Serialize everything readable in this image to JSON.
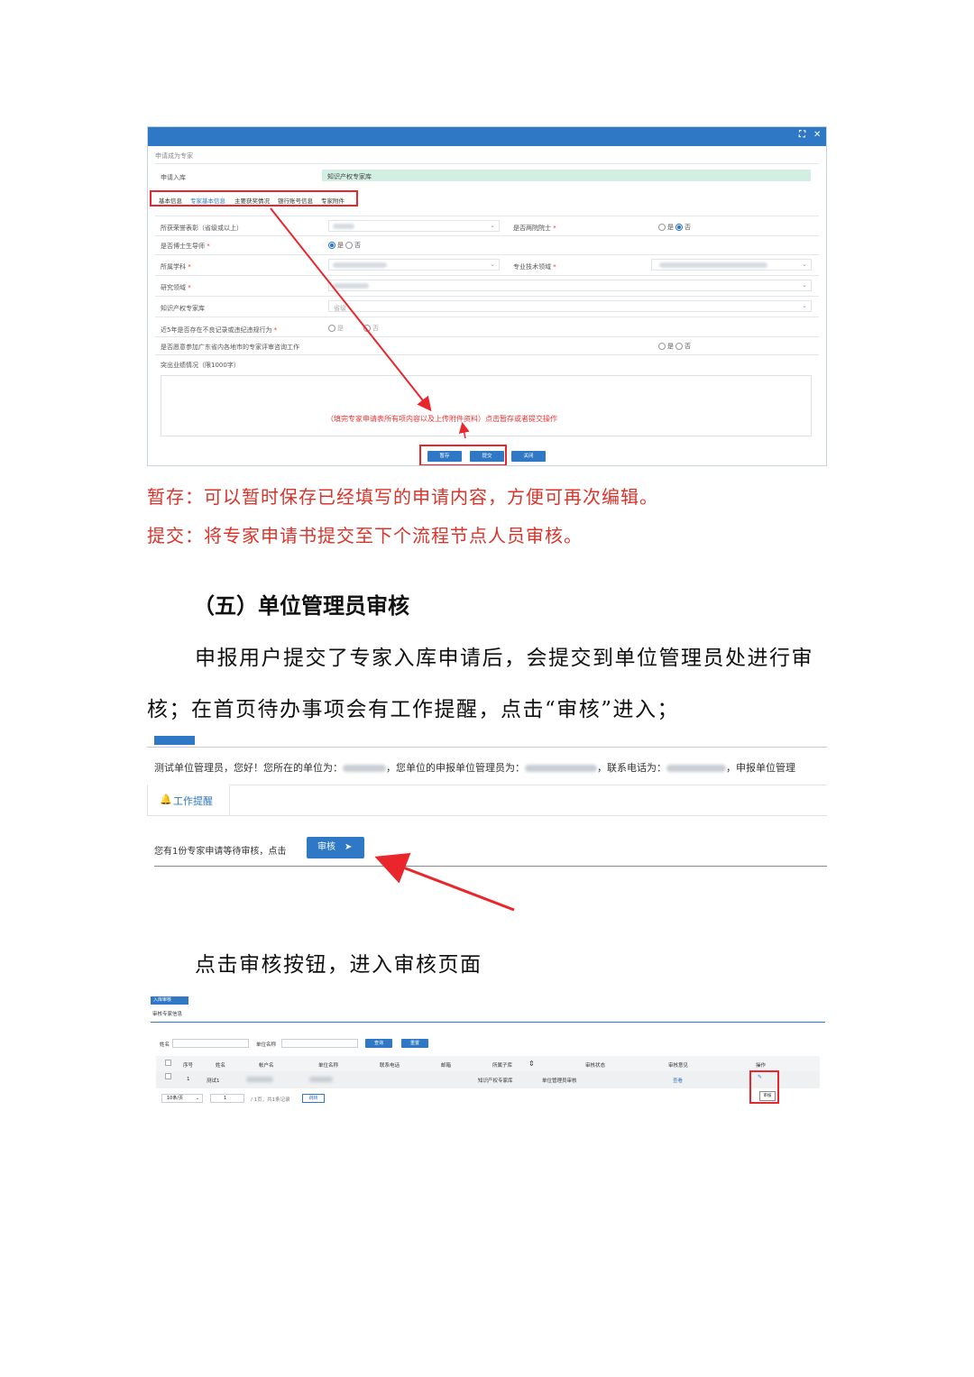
{
  "shot1": {
    "breadcrumb": "申请成为专家",
    "apply_library_label": "申请入库",
    "apply_library_value": "知识产权专家库",
    "tabs": [
      "基本信息",
      "专家基本信息",
      "主要获奖情况",
      "银行账号信息",
      "专家附件"
    ],
    "rows": {
      "honor": "所获荣誉表彰（省级或以上）",
      "academician": "是否两院院士",
      "doctoral_supervisor": "是否博士生导师",
      "discipline": "所属学科",
      "tech_field": "专业技术领域",
      "research_field": "研究领域",
      "ip_library": "知识产权专家库",
      "ip_library_value": "省级",
      "violation": "近5年是否存在不良记录或违纪违规行为",
      "willing": "是否愿意参加广东省内各地市的专家评审咨询工作",
      "achievement": "突出业绩情况（限1000字）"
    },
    "radio_yes": "是",
    "radio_no": "否",
    "annotation": "（填完专家申请表所有项内容以及上传附件资料）点击暂存或者提交操作",
    "buttons": {
      "save": "暂存",
      "submit": "提交",
      "close": "关闭"
    }
  },
  "text": {
    "save_desc": "暂存：可以暂时保存已经填写的申请内容，方便可再次编辑。",
    "submit_desc": "提交：将专家申请书提交至下个流程节点人员审核。",
    "heading": "（五）单位管理员审核",
    "para1_line1": "申报用户提交了专家入库申请后，会提交到单位管理员处进行审",
    "para1_line2": "核；在首页待办事项会有工作提醒，点击“审核”进入；",
    "para2": "点击审核按钮，进入审核页面"
  },
  "shot2": {
    "welcome_a": "测试单位管理员，您好！您所在的单位为：",
    "welcome_b": "，您单位的申报单位管理员为：",
    "welcome_c": "，联系电话为：",
    "welcome_d": "，申报单位管理",
    "tab_label": "工作提醒",
    "notice": "您有1份专家申请等待审核，点击",
    "review_button": "审核"
  },
  "shot3": {
    "tab": "入库审核",
    "section_title": "审核专家信息",
    "filter_name": "姓名",
    "filter_unit": "单位名称",
    "btn_query": "查询",
    "btn_reset": "重置",
    "columns": [
      "序号",
      "姓名",
      "帐户名",
      "单位名称",
      "联系电话",
      "邮箱",
      "所属子库",
      "审核状态",
      "审核意见",
      "操作"
    ],
    "row": {
      "index": "1",
      "name": "测试1",
      "library": "知识产权专家库",
      "status": "单位管理员审核",
      "opinion": "查看",
      "action": "审核"
    },
    "page_size": "10条/页",
    "page_num": "1",
    "page_info": "/ 1页，共1条记录",
    "go": "跳转"
  }
}
